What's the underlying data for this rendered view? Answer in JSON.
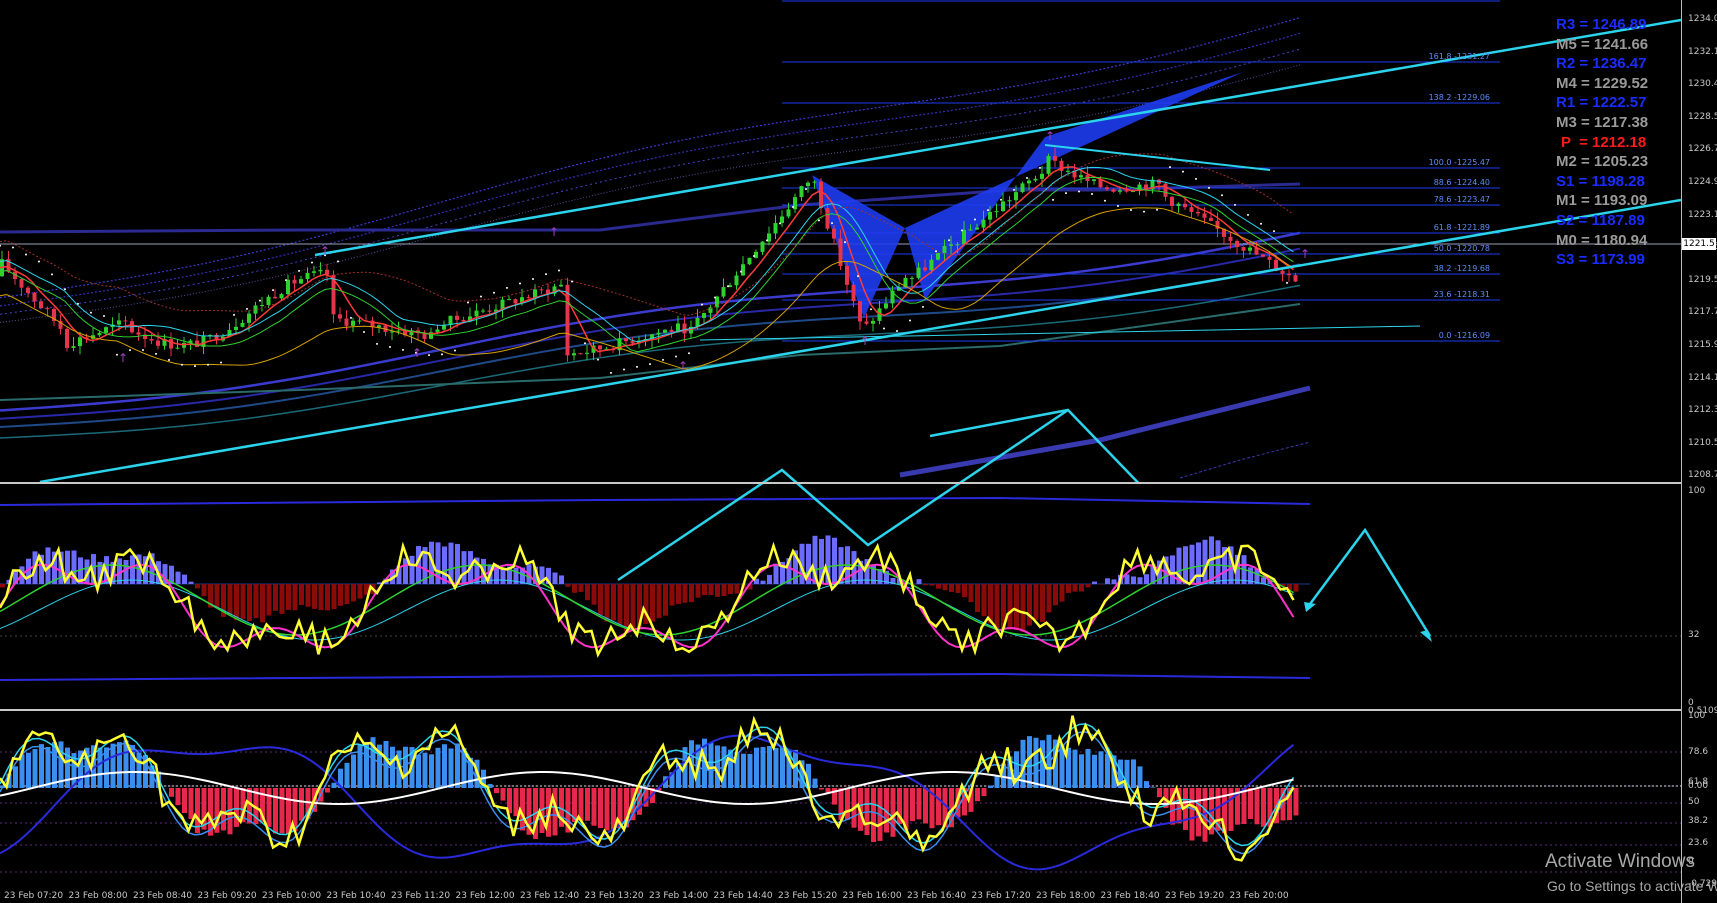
{
  "colors": {
    "background": "#000000",
    "bull_candle": "#2fd12f",
    "bear_candle": "#e8344a",
    "trendline": "#2bd4ec",
    "harmonic": "#1e3cf0",
    "macd_up": "#6b6bff",
    "macd_down": "#8b0a0a",
    "osc_up": "#3a8ef0",
    "osc_down": "#e8284a",
    "yellow": "#ffff33",
    "pivot_blue": "#1a2cff",
    "pivot_gray": "#9a9a9a",
    "pivot_red": "#ff1a1a"
  },
  "pivots": [
    {
      "label": "R3 = 1246.89",
      "color": "blue"
    },
    {
      "label": "M5 = 1241.66",
      "color": "gray"
    },
    {
      "label": "R2 = 1236.47",
      "color": "blue"
    },
    {
      "label": "M4 = 1229.52",
      "color": "gray"
    },
    {
      "label": "R1 = 1222.57",
      "color": "blue"
    },
    {
      "label": "M3 = 1217.38",
      "color": "gray"
    },
    {
      "label": "P  = 1212.18",
      "color": "red"
    },
    {
      "label": "M2 = 1205.23",
      "color": "gray"
    },
    {
      "label": "S1 = 1198.28",
      "color": "blue"
    },
    {
      "label": "M1 = 1193.09",
      "color": "gray"
    },
    {
      "label": "S2 = 1187.89",
      "color": "blue"
    },
    {
      "label": "M0 = 1180.94",
      "color": "gray"
    },
    {
      "label": "S3 = 1173.99",
      "color": "blue"
    }
  ],
  "price_axis": [
    "1234.0",
    "1232.1",
    "1230.4",
    "1228.5",
    "1226.7",
    "1224.9",
    "1223.1",
    "1221.5",
    "1219.5",
    "1217.7",
    "1215.9",
    "1214.1",
    "1212.3",
    "1210.5",
    "1208.7"
  ],
  "current_price": "1221.5",
  "fib_levels": [
    "161.8 -1231.27",
    "138.2 -1229.06",
    "100.0 -1225.47",
    "88.6 -1224.40",
    "78.6 -1223.47",
    "61.8 -1221.89",
    "50.0 -1220.78",
    "38.2 -1219.68",
    "23.6 -1218.31",
    "0.0 -1216.09"
  ],
  "macd_axis": {
    "top": "100",
    "mid": "32",
    "bottom": "0"
  },
  "osc_axis": [
    "0.5109",
    "100",
    "78.6",
    "61.8",
    "0.00",
    "50",
    "38.2",
    "23.6",
    "0",
    "-0.729"
  ],
  "time_axis": [
    "23 Feb 07:20",
    "23 Feb 08:00",
    "23 Feb 08:40",
    "23 Feb 09:20",
    "23 Feb 10:00",
    "23 Feb 10:40",
    "23 Feb 11:20",
    "23 Feb 12:00",
    "23 Feb 12:40",
    "23 Feb 13:20",
    "23 Feb 14:00",
    "23 Feb 14:40",
    "23 Feb 15:20",
    "23 Feb 16:00",
    "23 Feb 16:40",
    "23 Feb 17:20",
    "23 Feb 18:00",
    "23 Feb 18:40",
    "23 Feb 19:20",
    "23 Feb 20:00"
  ],
  "watermark": {
    "line1": "Activate Windows",
    "line2": "Go to Settings to activate Windows."
  }
}
